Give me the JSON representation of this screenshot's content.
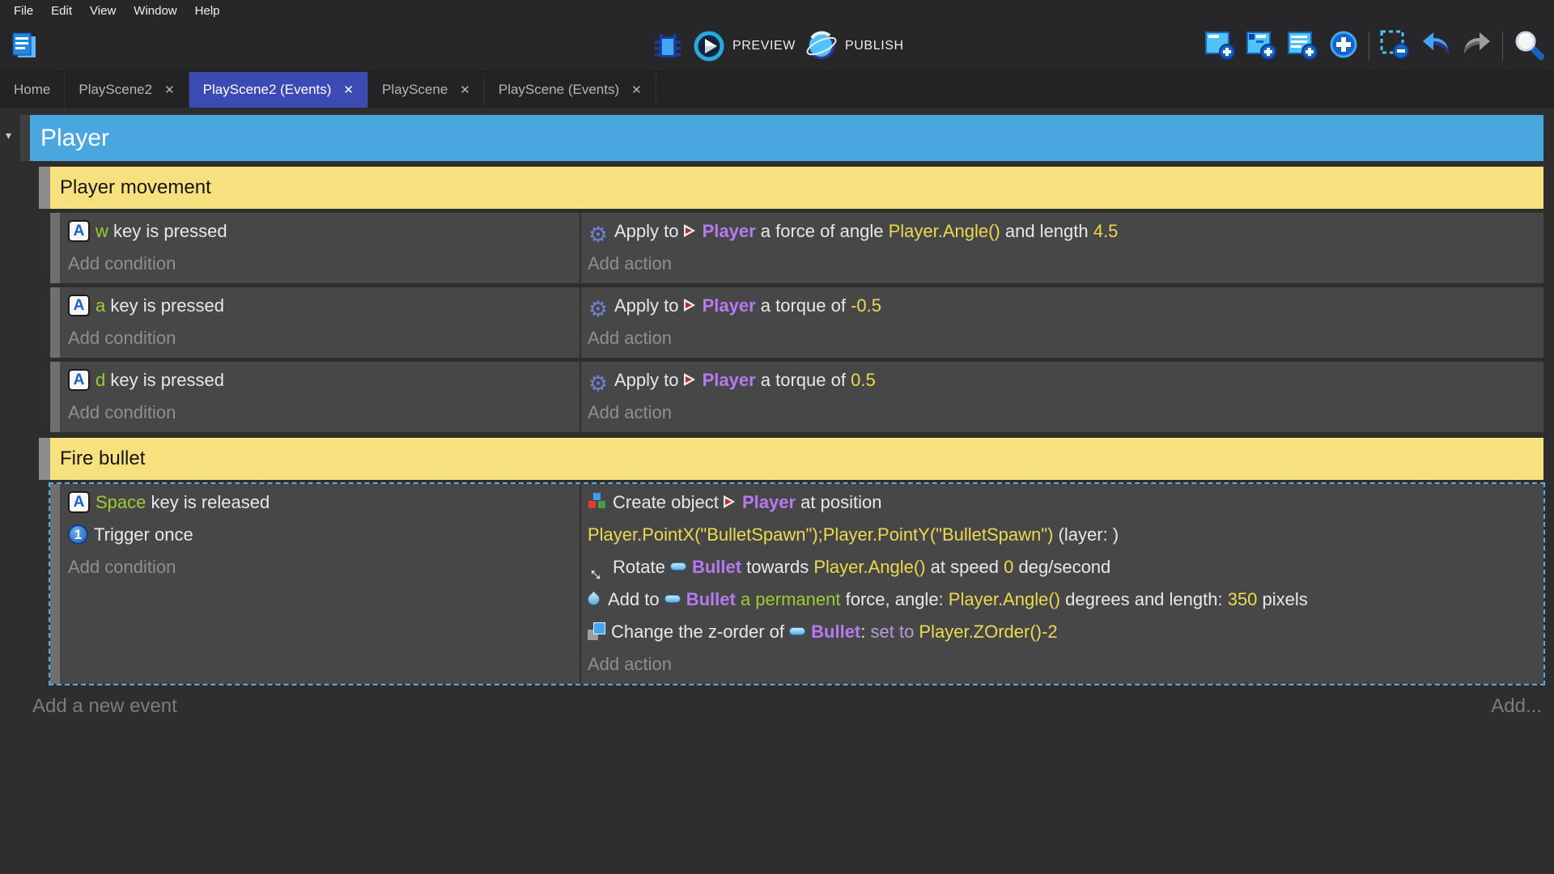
{
  "menu": {
    "items": [
      "File",
      "Edit",
      "View",
      "Window",
      "Help"
    ]
  },
  "toolbar": {
    "preview_label": "PREVIEW",
    "publish_label": "PUBLISH",
    "left_icons": [
      "project-manager"
    ],
    "center_icons": [
      "debug",
      "preview-play",
      "publish-globe"
    ],
    "right_icons": [
      "add-event",
      "add-sub-event",
      "add-comment",
      "add-new",
      "delete-selection",
      "undo",
      "redo",
      "search"
    ]
  },
  "tabs": [
    {
      "label": "Home",
      "closable": false,
      "active": false
    },
    {
      "label": "PlayScene2",
      "closable": true,
      "active": false
    },
    {
      "label": "PlayScene2 (Events)",
      "closable": true,
      "active": true
    },
    {
      "label": "PlayScene",
      "closable": true,
      "active": false
    },
    {
      "label": "PlayScene (Events)",
      "closable": true,
      "active": false
    }
  ],
  "sheet": {
    "group_title": "Player",
    "labels": {
      "add_condition": "Add condition",
      "add_action": "Add action"
    },
    "footer": {
      "add_new_event": "Add a new event",
      "add_more": "Add..."
    },
    "colors": {
      "group_header": "#4aa6df",
      "comment_bg": "#f7e17e",
      "active_tab": "#3c4ab4",
      "object_name": "#b57af0",
      "expression": "#ecd94f",
      "key_name": "#9acd32",
      "selection_outline": "#55aee0",
      "event_bg": "#474747"
    },
    "rows": [
      {
        "type": "comment",
        "text": "Player movement"
      },
      {
        "type": "event",
        "selected": false,
        "conditions": [
          [
            {
              "icon": "keyboard"
            },
            {
              "t": "w",
              "c": "key"
            },
            {
              "t": " key is pressed",
              "c": "txt"
            }
          ]
        ],
        "actions": [
          [
            {
              "icon": "physics"
            },
            {
              "t": "Apply to ",
              "c": "txt"
            },
            {
              "icon": "player"
            },
            {
              "t": "Player",
              "c": "obj"
            },
            {
              "t": " a force of angle ",
              "c": "txt"
            },
            {
              "t": "Player.Angle()",
              "c": "expr"
            },
            {
              "t": " and length ",
              "c": "txt"
            },
            {
              "t": "4.5",
              "c": "expr"
            }
          ]
        ]
      },
      {
        "type": "event",
        "selected": false,
        "conditions": [
          [
            {
              "icon": "keyboard"
            },
            {
              "t": "a",
              "c": "key"
            },
            {
              "t": " key is pressed",
              "c": "txt"
            }
          ]
        ],
        "actions": [
          [
            {
              "icon": "physics"
            },
            {
              "t": "Apply to ",
              "c": "txt"
            },
            {
              "icon": "player"
            },
            {
              "t": "Player",
              "c": "obj"
            },
            {
              "t": " a torque of ",
              "c": "txt"
            },
            {
              "t": "-0.5",
              "c": "expr"
            }
          ]
        ]
      },
      {
        "type": "event",
        "selected": false,
        "conditions": [
          [
            {
              "icon": "keyboard"
            },
            {
              "t": "d",
              "c": "key"
            },
            {
              "t": " key is pressed",
              "c": "txt"
            }
          ]
        ],
        "actions": [
          [
            {
              "icon": "physics"
            },
            {
              "t": "Apply to ",
              "c": "txt"
            },
            {
              "icon": "player"
            },
            {
              "t": "Player",
              "c": "obj"
            },
            {
              "t": " a torque of ",
              "c": "txt"
            },
            {
              "t": "0.5",
              "c": "expr"
            }
          ]
        ]
      },
      {
        "type": "comment",
        "text": "Fire bullet"
      },
      {
        "type": "event",
        "selected": true,
        "conditions": [
          [
            {
              "icon": "keyboard"
            },
            {
              "t": "Space",
              "c": "key"
            },
            {
              "t": " key is released",
              "c": "txt"
            }
          ],
          [
            {
              "icon": "trigger"
            },
            {
              "t": "Trigger once",
              "c": "txt"
            }
          ]
        ],
        "actions": [
          [
            {
              "icon": "create"
            },
            {
              "t": "Create object ",
              "c": "txt"
            },
            {
              "icon": "player"
            },
            {
              "t": "Player",
              "c": "obj"
            },
            {
              "t": " at position",
              "c": "txt"
            }
          ],
          [
            {
              "t": "Player.PointX(\"BulletSpawn\");Player.PointY(\"BulletSpawn\")",
              "c": "expr"
            },
            {
              "t": " (layer: )",
              "c": "txt"
            }
          ],
          [
            {
              "icon": "rotate"
            },
            {
              "t": "Rotate ",
              "c": "txt"
            },
            {
              "icon": "bullet"
            },
            {
              "t": "Bullet",
              "c": "obj"
            },
            {
              "t": " towards ",
              "c": "txt"
            },
            {
              "t": "Player.Angle()",
              "c": "expr"
            },
            {
              "t": " at speed ",
              "c": "txt"
            },
            {
              "t": "0",
              "c": "expr"
            },
            {
              "t": " deg/second",
              "c": "txt"
            }
          ],
          [
            {
              "icon": "force"
            },
            {
              "t": "Add to ",
              "c": "txt"
            },
            {
              "icon": "bullet"
            },
            {
              "t": "Bullet",
              "c": "obj"
            },
            {
              "t": " a permanent",
              "c": "perm"
            },
            {
              "t": " force, angle: ",
              "c": "txt"
            },
            {
              "t": "Player.Angle()",
              "c": "expr"
            },
            {
              "t": " degrees and length: ",
              "c": "txt"
            },
            {
              "t": "350",
              "c": "expr"
            },
            {
              "t": " pixels",
              "c": "txt"
            }
          ],
          [
            {
              "icon": "zorder"
            },
            {
              "t": "Change the z-order of ",
              "c": "txt"
            },
            {
              "icon": "bullet"
            },
            {
              "t": "Bullet",
              "c": "obj"
            },
            {
              "t": ": ",
              "c": "txt"
            },
            {
              "t": "set to ",
              "c": "setto"
            },
            {
              "t": "Player.ZOrder()-2",
              "c": "expr"
            }
          ]
        ]
      }
    ]
  }
}
